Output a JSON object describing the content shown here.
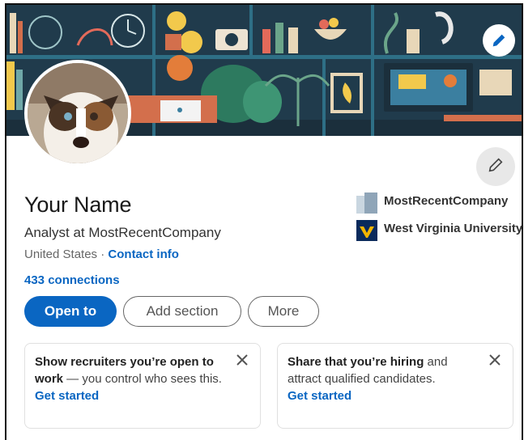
{
  "profile": {
    "name": "Your Name",
    "headline": "Analyst at MostRecentCompany",
    "location": "United States",
    "separator": " · ",
    "contact_label": "Contact info",
    "connections": "433 connections"
  },
  "sidebar": {
    "company": "MostRecentCompany",
    "school": "West Virginia University"
  },
  "actions": {
    "open_to": "Open to",
    "add_section": "Add section",
    "more": "More"
  },
  "promos": [
    {
      "bold": "Show recruiters you’re open to work",
      "text": " — you control who sees this.",
      "link": "Get started"
    },
    {
      "bold": "Share that you’re hiring",
      "text": " and attract qualified candidates.",
      "link": "Get started"
    }
  ],
  "colors": {
    "primary": "#0a66c2",
    "banner_bg": "#1f3a4a"
  },
  "icons": {
    "banner_edit": "pencil-icon",
    "profile_edit": "pencil-icon",
    "close": "close-icon"
  }
}
